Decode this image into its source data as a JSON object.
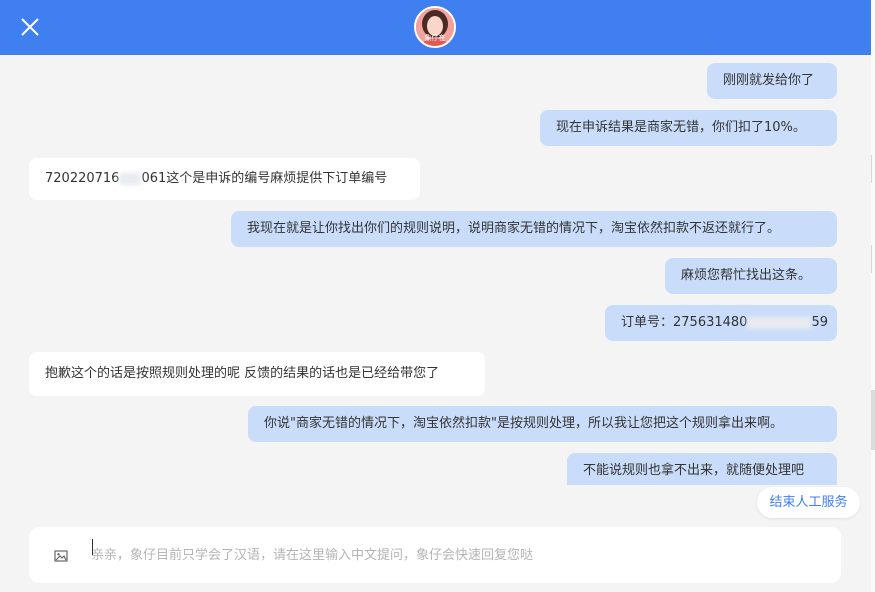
{
  "header": {
    "close_icon": "close-icon",
    "avatar_label": "象仔在"
  },
  "messages": [
    {
      "side": "out",
      "text": "刚刚就发给你了"
    },
    {
      "side": "out",
      "text": "现在申诉结果是商家无错，你们扣了10%。"
    },
    {
      "side": "in",
      "text_before": "720220716",
      "text_after": "061这个是申诉的编号麻烦提供下订单编号"
    },
    {
      "side": "out",
      "text": "我现在就是让你找出你们的规则说明，说明商家无错的情况下，淘宝依然扣款不返还就行了。"
    },
    {
      "side": "out",
      "text": "麻烦您帮忙找出这条。"
    },
    {
      "side": "out",
      "text_before": "订单号：275631480",
      "text_after": "59"
    },
    {
      "side": "in",
      "text": "抱歉这个的话是按照规则处理的呢 反馈的结果的话也是已经给带您了"
    },
    {
      "side": "out",
      "text": "你说\"商家无错的情况下，淘宝依然扣款\"是按规则处理，所以我让您把这个规则拿出来啊。"
    },
    {
      "side": "out",
      "text": "不能说规则也拿不出来，就随便处理吧"
    }
  ],
  "end_service": {
    "label": "结束人工服务"
  },
  "composer": {
    "image_icon": "image-icon",
    "placeholder": "亲亲，象仔目前只学会了汉语，请在这里输入中文提问，象仔会快速回复您哒",
    "value": ""
  },
  "colors": {
    "header": "#3f7ff0",
    "outgoing_bubble": "#c9ddfb",
    "incoming_bubble": "#ffffff",
    "accent": "#3f7ff0"
  }
}
